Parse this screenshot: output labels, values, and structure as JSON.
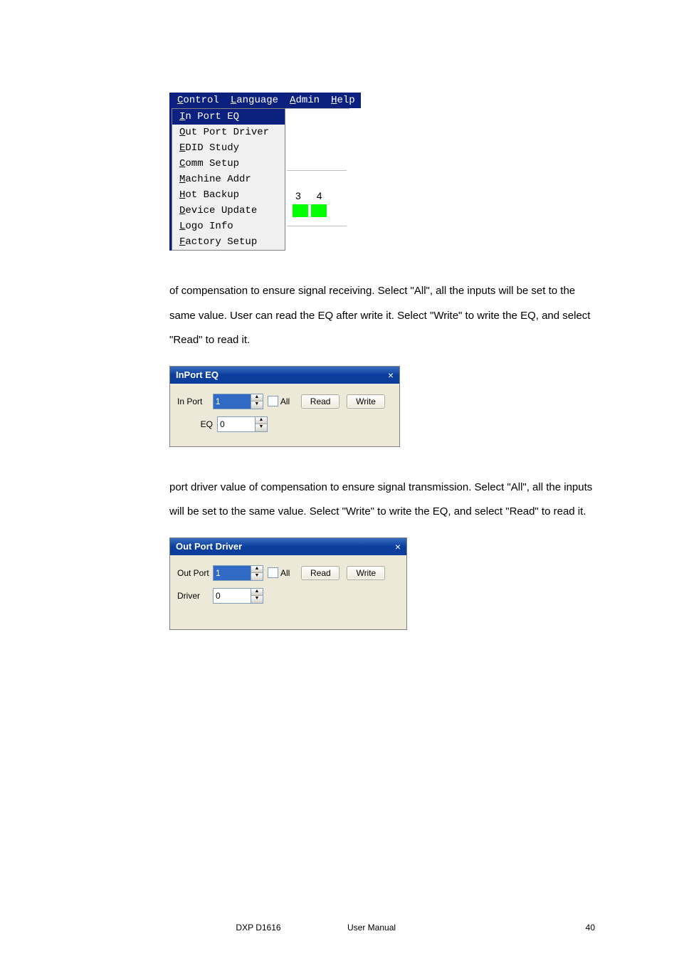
{
  "menu": {
    "bar": [
      "Control",
      "Language",
      "Admin",
      "Help"
    ],
    "dropdown": [
      {
        "label": "In Port EQ",
        "u": "I",
        "selected": true
      },
      {
        "label": "Out Port Driver",
        "u": "O"
      },
      {
        "label": "EDID Study",
        "u": "E"
      },
      {
        "label": "Comm Setup",
        "u": "C"
      },
      {
        "label": "Machine Addr",
        "u": "M"
      },
      {
        "label": "Hot Backup",
        "u": "H"
      },
      {
        "label": "Device Update",
        "u": "D"
      },
      {
        "label": "Logo Info",
        "u": "L"
      },
      {
        "label": "Factory Setup",
        "u": "F"
      }
    ],
    "right_nums": [
      "3",
      "4"
    ]
  },
  "para1": "of compensation to ensure signal receiving. Select \"All\", all the inputs will be set to the same value. User can read the EQ after write it. Select \"Write\" to write the EQ, and select \"Read\" to read it.",
  "dialog1": {
    "title": "InPort EQ",
    "close": "×",
    "rows": [
      {
        "label": "In Port",
        "value": "1",
        "sel": true,
        "all": "All",
        "read": "Read",
        "write": "Write"
      },
      {
        "label": "EQ",
        "value": "0"
      }
    ]
  },
  "para2": "port driver value of compensation to ensure signal transmission. Select \"All\", all the inputs will be set to the same value. Select \"Write\" to write the EQ, and select \"Read\" to read it.",
  "dialog2": {
    "title": "Out Port Driver",
    "close": "×",
    "rows": [
      {
        "label": "Out Port",
        "value": "1",
        "sel": true,
        "all": "All",
        "read": "Read",
        "write": "Write"
      },
      {
        "label": "Driver",
        "value": "0"
      }
    ]
  },
  "footer": {
    "left": "DXP D1616",
    "center": "User Manual",
    "page": "40"
  }
}
